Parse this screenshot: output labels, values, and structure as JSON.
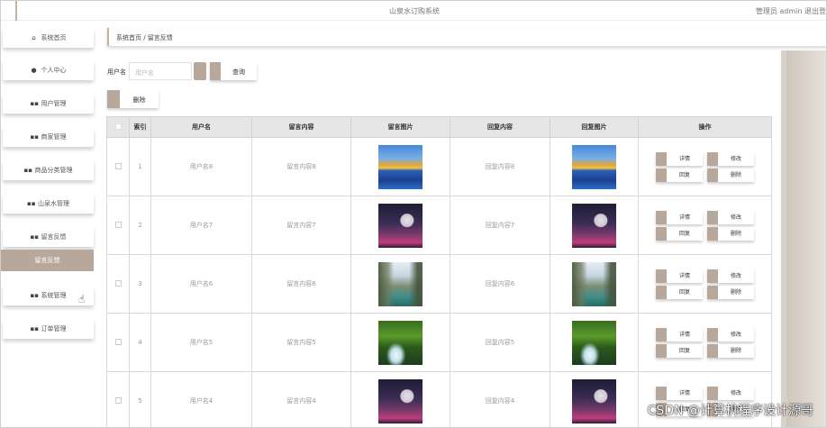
{
  "header": {
    "title": "山泉水订购系统",
    "user_info": "管理员 admin  退出登"
  },
  "sidebar": {
    "items": [
      {
        "label": "系统首页",
        "icon": "home-icon",
        "glyph": "⌂"
      },
      {
        "label": "个人中心",
        "icon": "person-icon",
        "glyph": "●"
      },
      {
        "label": "用户管理",
        "icon": "grid-icon",
        "glyph": "▪▪"
      },
      {
        "label": "商家管理",
        "icon": "grid-icon",
        "glyph": "▪▪"
      },
      {
        "label": "商品分类管理",
        "icon": "grid-icon",
        "glyph": "▪▪"
      },
      {
        "label": "山泉水管理",
        "icon": "grid-icon",
        "glyph": "▪▪"
      },
      {
        "label": "留言反馈",
        "icon": "grid-icon",
        "glyph": "▪▪"
      },
      {
        "label": "留言反馈",
        "icon": "",
        "glyph": "",
        "active": true
      },
      {
        "label": "系统管理",
        "icon": "grid-icon",
        "glyph": "▪▪"
      },
      {
        "label": "订单管理",
        "icon": "grid-icon",
        "glyph": "▪▪"
      }
    ]
  },
  "breadcrumb": "系统首页  /  留言反馈",
  "search": {
    "label": "用户名",
    "placeholder": "用户名",
    "query_button": "查询"
  },
  "delete_button": "删除",
  "table": {
    "headers": [
      "",
      "索引",
      "用户名",
      "留言内容",
      "留言图片",
      "回复内容",
      "回复图片",
      "操作"
    ],
    "rows": [
      {
        "index": "1",
        "username": "用户名8",
        "content": "留言内容8",
        "image": "waterfall",
        "reply": "回复内容8",
        "reply_image": "waterfall"
      },
      {
        "index": "2",
        "username": "用户名7",
        "content": "留言内容7",
        "image": "moon",
        "reply": "回复内容7",
        "reply_image": "moon"
      },
      {
        "index": "3",
        "username": "用户名6",
        "content": "留言内容6",
        "image": "canyon",
        "reply": "回复内容6",
        "reply_image": "canyon"
      },
      {
        "index": "4",
        "username": "用户名5",
        "content": "留言内容5",
        "image": "forest-falls",
        "reply": "回复内容5",
        "reply_image": "forest-falls"
      },
      {
        "index": "5",
        "username": "用户名4",
        "content": "留言内容4",
        "image": "moon",
        "reply": "回复内容4",
        "reply_image": "moon"
      }
    ],
    "ops": {
      "detail": "详情",
      "edit": "修改",
      "reply": "回复",
      "delete": "删除"
    }
  },
  "watermark": "CSDN @计算机程序设计源哥",
  "colors": {
    "accent": "#b7a89b"
  }
}
